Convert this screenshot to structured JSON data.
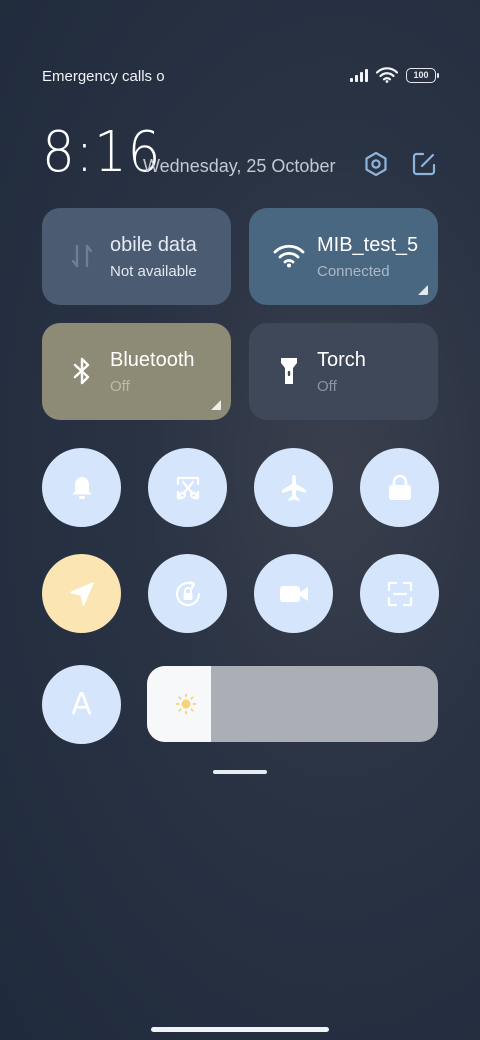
{
  "status_bar": {
    "carrier_text": "Emergency calls o",
    "battery": "100",
    "icons": [
      "signal-icon",
      "wifi-icon",
      "battery-icon"
    ]
  },
  "header": {
    "time": "8:16",
    "date": "Wednesday, 25 October",
    "icons": [
      "settings-icon",
      "edit-icon"
    ]
  },
  "tiles": {
    "mobile_data": {
      "title": "obile data",
      "subtitle": "Not available",
      "icon": "mobile-data-icon",
      "color": "#4a5b72"
    },
    "wifi": {
      "title": "MIB_test_5",
      "subtitle": "Connected",
      "icon": "wifi-icon",
      "color": "#4a6782"
    },
    "bluetooth": {
      "title": "Bluetooth",
      "subtitle": "Off",
      "icon": "bluetooth-icon",
      "color": "#8d8a76"
    },
    "torch": {
      "title": "Torch",
      "subtitle": "Off",
      "icon": "torch-icon",
      "color": "#3f4858"
    }
  },
  "toggles": [
    {
      "name": "bell-icon",
      "active": false
    },
    {
      "name": "screenshot-icon",
      "active": false
    },
    {
      "name": "airplane-icon",
      "active": false
    },
    {
      "name": "lock-icon",
      "active": false
    },
    {
      "name": "location-icon",
      "active": true
    },
    {
      "name": "rotation-lock-icon",
      "active": false
    },
    {
      "name": "video-camera-icon",
      "active": false
    },
    {
      "name": "scanner-icon",
      "active": false
    }
  ],
  "auto_brightness_label": "A",
  "brightness": {
    "level_fraction": 0.22,
    "icon": "sun-icon"
  },
  "colors": {
    "toggle_inactive": "#d5e5fb",
    "toggle_active": "#fbe5b2",
    "icon_inactive": "#ffffff"
  }
}
